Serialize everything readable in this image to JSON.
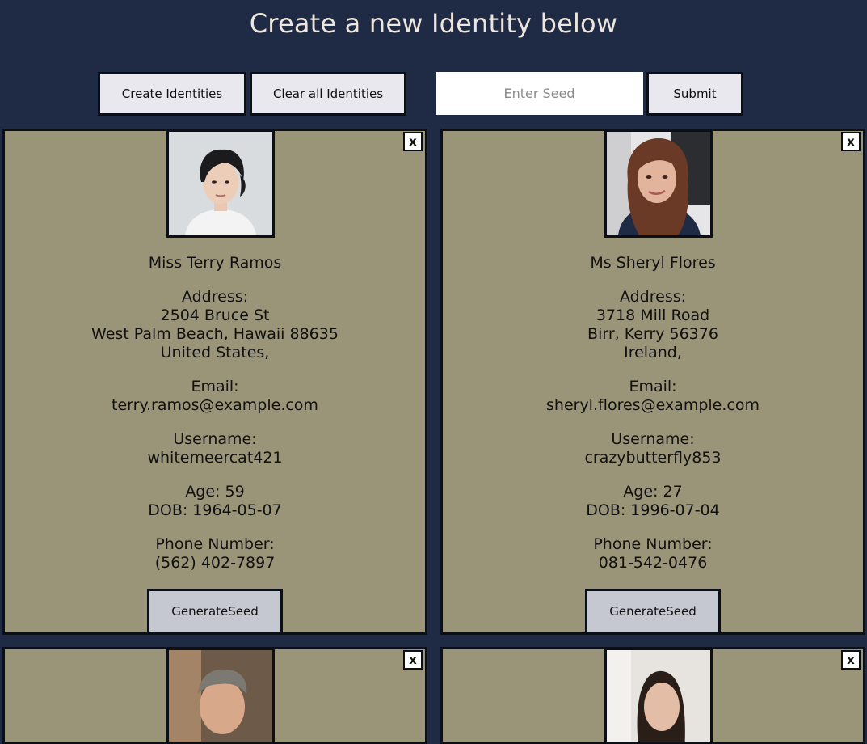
{
  "page": {
    "title": "Create a new Identity below",
    "create_label": "Create Identities",
    "clear_label": "Clear all Identities",
    "seed_placeholder": "Enter Seed",
    "submit_label": "Submit"
  },
  "cards": [
    {
      "close_label": "x",
      "name": "Miss Terry Ramos",
      "address_label": "Address:",
      "street": "2504 Bruce St",
      "city_line": "West Palm Beach, Hawaii 88635",
      "country": "United States,",
      "email_label": "Email:",
      "email": "terry.ramos@example.com",
      "username_label": "Username:",
      "username": "whitemeercat421",
      "age": "Age: 59",
      "dob": "DOB: 1964-05-07",
      "phone_label": "Phone Number:",
      "phone": "(562) 402-7897",
      "generate_label": "GenerateSeed"
    },
    {
      "close_label": "x",
      "name": "Ms Sheryl Flores",
      "address_label": "Address:",
      "street": "3718 Mill Road",
      "city_line": "Birr, Kerry 56376",
      "country": "Ireland,",
      "email_label": "Email:",
      "email": "sheryl.flores@example.com",
      "username_label": "Username:",
      "username": "crazybutterfly853",
      "age": "Age: 27",
      "dob": "DOB: 1996-07-04",
      "phone_label": "Phone Number:",
      "phone": "081-542-0476",
      "generate_label": "GenerateSeed"
    },
    {
      "close_label": "x"
    },
    {
      "close_label": "x"
    }
  ],
  "colors": {
    "background": "#1f2a44",
    "card": "#9a9478",
    "button": "#e9e8ee",
    "generate_button": "#c6c8d1"
  }
}
